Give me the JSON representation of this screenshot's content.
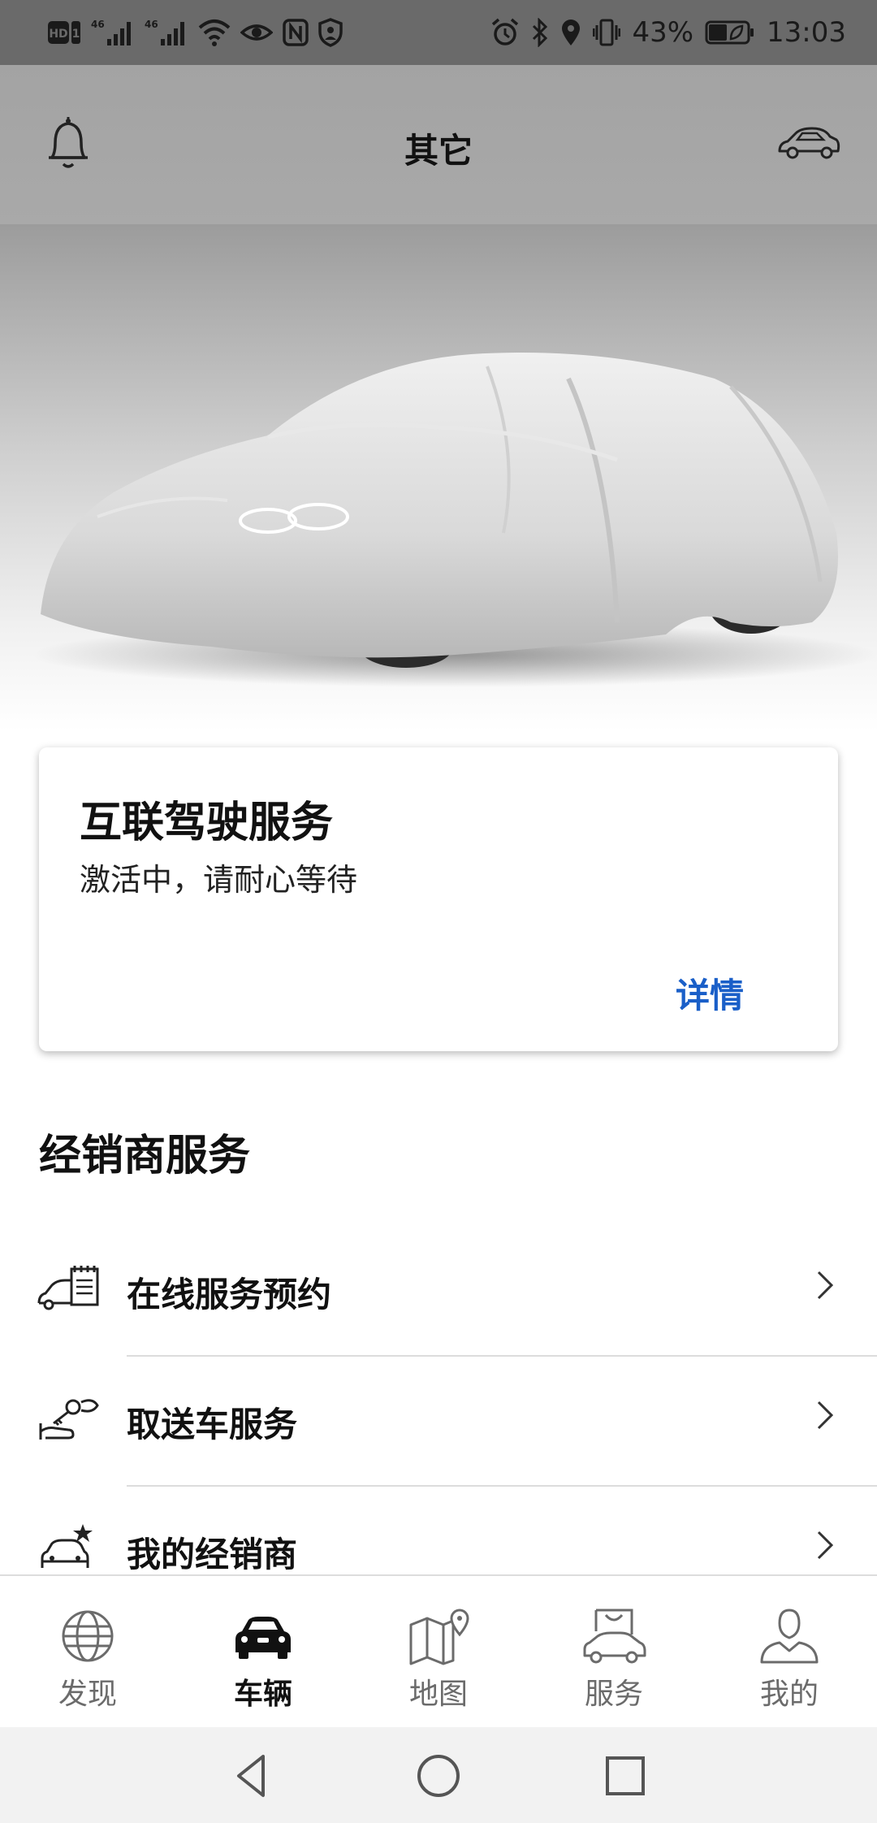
{
  "status_bar": {
    "left_icons": [
      "hd-icon",
      "sim1-icon",
      "signal-4g-icon",
      "signal-4g-icon",
      "wifi-icon",
      "eye-icon",
      "nfc-icon",
      "shield-icon"
    ],
    "right_icons": [
      "alarm-icon",
      "bluetooth-icon",
      "location-icon",
      "vibrate-icon",
      "battery-icon"
    ],
    "battery": "43%",
    "time": "13:03"
  },
  "header": {
    "title": "其它"
  },
  "card": {
    "title": "互联驾驶服务",
    "subtitle": "激活中，请耐心等待",
    "link": "详情"
  },
  "dealer_section": {
    "title": "经销商服务",
    "items": [
      {
        "label": "在线服务预约",
        "icon": "car-calendar-icon"
      },
      {
        "label": "取送车服务",
        "icon": "key-handover-icon"
      },
      {
        "label": "我的经销商",
        "icon": "car-star-icon"
      }
    ]
  },
  "tabbar": {
    "tabs": [
      {
        "label": "发现",
        "icon": "globe-icon",
        "active": false
      },
      {
        "label": "车辆",
        "icon": "car-icon",
        "active": true
      },
      {
        "label": "地图",
        "icon": "map-icon",
        "active": false
      },
      {
        "label": "服务",
        "icon": "shopping-bag-car-icon",
        "active": false
      },
      {
        "label": "我的",
        "icon": "person-icon",
        "active": false
      }
    ]
  },
  "colors": {
    "accent": "#1a5fc8",
    "header_bg": "#a6a6a6",
    "status_bar_bg": "#6a6a6a"
  }
}
